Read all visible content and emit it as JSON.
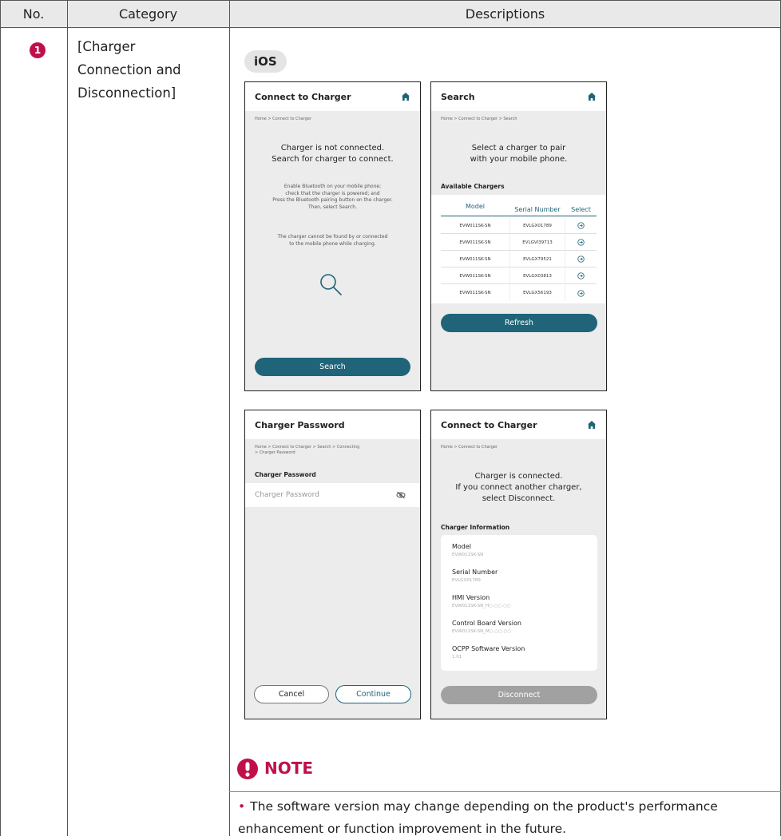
{
  "table": {
    "headers": [
      "No.",
      "Category",
      "Descriptions"
    ],
    "row_number": "1",
    "category": "[Charger Connection and Disconnection]"
  },
  "platform_label": "iOS",
  "icons": {
    "home": "home-icon",
    "search": "search-icon",
    "select": "arrow-circle-icon",
    "eye_off": "eye-slash-icon",
    "note": "exclamation-icon"
  },
  "colors": {
    "accent": "#c0104a",
    "teal": "#1f6479",
    "disabled": "#a1a1a1"
  },
  "screen_connect": {
    "title": "Connect to Charger",
    "breadcrumb": "Home > Connect to Charger",
    "status_line1": "Charger is not connected.",
    "status_line2": "Search for charger to connect.",
    "instr1": "Enable Bluetooth on your mobile phone;",
    "instr2": "check that the charger is powered; and",
    "instr3": "Press the Bluetooth pairing button on the charger.",
    "instr4": "Then, select Search.",
    "warn1": "The charger cannot be found by or connected",
    "warn2": "to the mobile phone while charging.",
    "button": "Search"
  },
  "screen_search": {
    "title": "Search",
    "breadcrumb": "Home > Connect to Charger > Search",
    "prompt1": "Select a charger to pair",
    "prompt2": "with your mobile phone.",
    "section": "Available Chargers",
    "columns": [
      "Model",
      "Serial Number",
      "Select"
    ],
    "rows": [
      {
        "model": "EVW011SK-SN",
        "serial": "EVLGX01789"
      },
      {
        "model": "EVW011SK-SN",
        "serial": "EVLGVI39713"
      },
      {
        "model": "EVW011SK-SN",
        "serial": "EVLGX79521"
      },
      {
        "model": "EVW011SK-SN",
        "serial": "EVLGX03813"
      },
      {
        "model": "EVW011SK-SN",
        "serial": "EVLGX56193"
      }
    ],
    "button": "Refresh"
  },
  "screen_password": {
    "title": "Charger Password",
    "breadcrumb1": "Home > Connect to Charger > Search > Connecting",
    "breadcrumb2": "> Charger Password",
    "section": "Charger Password",
    "placeholder": "Charger Password",
    "cancel": "Cancel",
    "continue": "Continue"
  },
  "screen_connected": {
    "title": "Connect to Charger",
    "breadcrumb": "Home > Connect to Charger",
    "status1": "Charger is connected.",
    "status2": "If you connect another charger,",
    "status3": "select Disconnect.",
    "section": "Charger Information",
    "info": [
      {
        "label": "Model",
        "value": "EVW011SK-SN"
      },
      {
        "label": "Serial Number",
        "value": "EVLGX01789"
      },
      {
        "label": "HMI Version",
        "value": "EVW011SK-SN_H○.○○.○○"
      },
      {
        "label": "Control Board Version",
        "value": "EVW011SK-SN_M○.○○.○○"
      },
      {
        "label": "OCPP Software Version",
        "value": "1.01"
      }
    ],
    "button": "Disconnect"
  },
  "note": {
    "title": "NOTE",
    "bullet": "•",
    "text": "The software version may change depending on the product's performance enhancement or function improvement in the future."
  }
}
